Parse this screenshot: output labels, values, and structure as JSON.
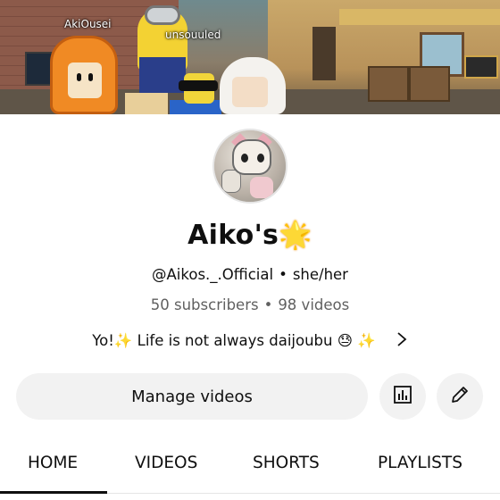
{
  "banner": {
    "player_names": [
      "AkiOusei",
      "unsouuled"
    ]
  },
  "channel": {
    "name": "Aiko's",
    "name_emoji": "🌟",
    "handle": "@Aikos._.Official",
    "pronouns": "she/her",
    "separator": "•",
    "subscribers": "50 subscribers",
    "videos_count": "98 videos",
    "description": "Yo!✨ Life is not always daijoubu 😓  ✨"
  },
  "actions": {
    "manage_videos_label": "Manage videos",
    "analytics_icon": "analytics-icon",
    "edit_icon": "pencil-icon"
  },
  "tabs": [
    {
      "label": "HOME",
      "selected": true
    },
    {
      "label": "VIDEOS",
      "selected": false
    },
    {
      "label": "SHORTS",
      "selected": false
    },
    {
      "label": "PLAYLISTS",
      "selected": false
    }
  ],
  "colors": {
    "text_primary": "#0f0f0f",
    "text_secondary": "#606060",
    "button_bg": "#f2f2f2"
  }
}
